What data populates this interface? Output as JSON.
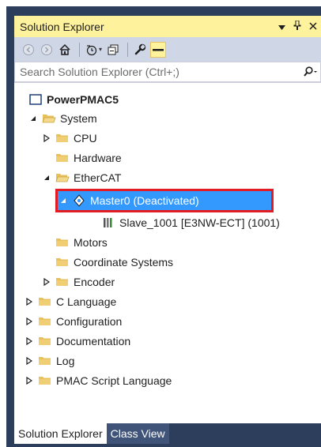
{
  "panel": {
    "title": "Solution Explorer",
    "pin_glyph": "↕",
    "close_glyph": "×"
  },
  "search": {
    "placeholder": "Search Solution Explorer (Ctrl+;)"
  },
  "tree": {
    "root": "PowerPMAC5",
    "system": "System",
    "cpu": "CPU",
    "hardware": "Hardware",
    "ethercat": "EtherCAT",
    "master": "Master0 (Deactivated)",
    "slave": "Slave_1001 [E3NW-ECT] (1001)",
    "motors": "Motors",
    "coordinate_systems": "Coordinate Systems",
    "encoder": "Encoder",
    "c_language": "C Language",
    "configuration": "Configuration",
    "documentation": "Documentation",
    "log": "Log",
    "pmac_script": "PMAC Script Language"
  },
  "tabs": {
    "solution_explorer": "Solution Explorer",
    "class_view": "Class View"
  },
  "colors": {
    "title_bg": "#fff29d",
    "selection": "#3399ff",
    "highlight": "#e31b23",
    "folder": "#e8c15c"
  }
}
